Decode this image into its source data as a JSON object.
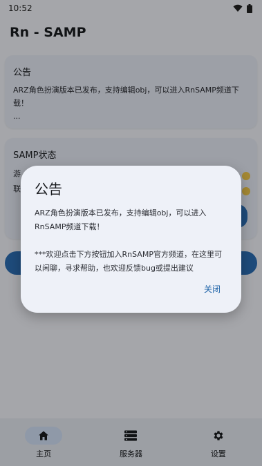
{
  "status_bar": {
    "time": "10:52"
  },
  "app": {
    "title": "Rn - SAMP"
  },
  "announcement_card": {
    "title": "公告",
    "text": "ARZ角色扮演版本已发布，支持编辑obj，可以进入RnSAMP频道下载！",
    "ellipsis": "..."
  },
  "status_card": {
    "title": "SAMP状态",
    "row1_prefix": "游",
    "row2_prefix": "联"
  },
  "dialog": {
    "title": "公告",
    "body": "ARZ角色扮演版本已发布，支持编辑obj，可以进入RnSAMP频道下载！\n\n***欢迎点击下方按钮加入RnSAMP官方频道，在这里可以闲聊，寻求帮助，也欢迎反馈bug或提出建议",
    "close_label": "关闭"
  },
  "nav": {
    "items": [
      {
        "label": "主页",
        "icon": "home-icon",
        "active": true
      },
      {
        "label": "服务器",
        "icon": "server-icon",
        "active": false
      },
      {
        "label": "设置",
        "icon": "gear-icon",
        "active": false
      }
    ]
  },
  "colors": {
    "accent": "#2d6fb5",
    "dialog_bg": "#eef1f8",
    "nav_bg": "#e6eaf2",
    "nav_active_pill": "#d3e2f8"
  }
}
